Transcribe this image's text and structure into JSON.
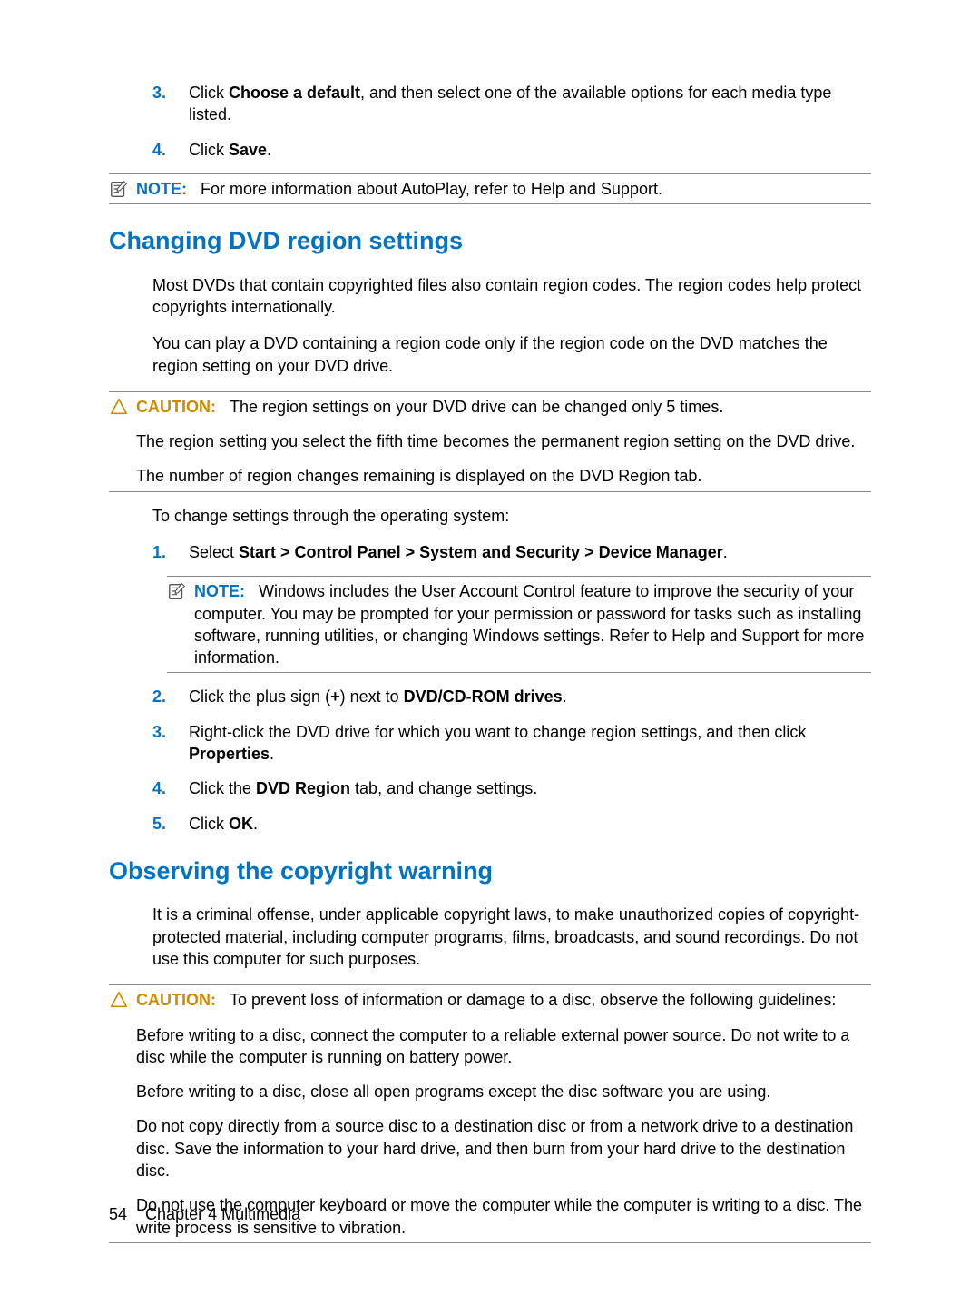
{
  "top_steps": [
    {
      "num": "3.",
      "pre": "Click ",
      "bold": "Choose a default",
      "post": ", and then select one of the available options for each media type listed."
    },
    {
      "num": "4.",
      "pre": "Click ",
      "bold": "Save",
      "post": "."
    }
  ],
  "top_note": {
    "label": "NOTE:",
    "text": "For more information about AutoPlay, refer to Help and Support."
  },
  "s1": {
    "heading": "Changing DVD region settings",
    "p1": "Most DVDs that contain copyrighted files also contain region codes. The region codes help protect copyrights internationally.",
    "p2": "You can play a DVD containing a region code only if the region code on the DVD matches the region setting on your DVD drive.",
    "caution": {
      "label": "CAUTION:",
      "c1": "The region settings on your DVD drive can be changed only 5 times.",
      "c2": "The region setting you select the fifth time becomes the permanent region setting on the DVD drive.",
      "c3": "The number of region changes remaining is displayed on the DVD Region tab."
    },
    "p3": "To change settings through the operating system:",
    "steps": [
      {
        "num": "1.",
        "pre": "Select ",
        "bold": "Start > Control Panel > System and Security > Device Manager",
        "post": "."
      },
      {
        "num": "2.",
        "pre": "Click the plus sign (",
        "bold1": "+",
        "mid": ") next to ",
        "bold2": "DVD/CD-ROM drives",
        "post": "."
      },
      {
        "num": "3.",
        "pre": "Right-click the DVD drive for which you want to change region settings, and then click ",
        "bold": "Properties",
        "post": "."
      },
      {
        "num": "4.",
        "pre": "Click the ",
        "bold": "DVD Region",
        "post": " tab, and change settings."
      },
      {
        "num": "5.",
        "pre": "Click ",
        "bold": "OK",
        "post": "."
      }
    ],
    "step1_note": {
      "label": "NOTE:",
      "text": "Windows includes the User Account Control feature to improve the security of your computer. You may be prompted for your permission or password for tasks such as installing software, running utilities, or changing Windows settings. Refer to Help and Support for more information."
    }
  },
  "s2": {
    "heading": "Observing the copyright warning",
    "p1": "It is a criminal offense, under applicable copyright laws, to make unauthorized copies of copyright-protected material, including computer programs, films, broadcasts, and sound recordings. Do not use this computer for such purposes.",
    "caution": {
      "label": "CAUTION:",
      "c1": "To prevent loss of information or damage to a disc, observe the following guidelines:",
      "c2": "Before writing to a disc, connect the computer to a reliable external power source. Do not write to a disc while the computer is running on battery power.",
      "c3": "Before writing to a disc, close all open programs except the disc software you are using.",
      "c4": "Do not copy directly from a source disc to a destination disc or from a network drive to a destination disc. Save the information to your hard drive, and then burn from your hard drive to the destination disc.",
      "c5": "Do not use the computer keyboard or move the computer while the computer is writing to a disc. The write process is sensitive to vibration."
    }
  },
  "footer": {
    "page": "54",
    "chapter": "Chapter 4   Multimedia"
  }
}
